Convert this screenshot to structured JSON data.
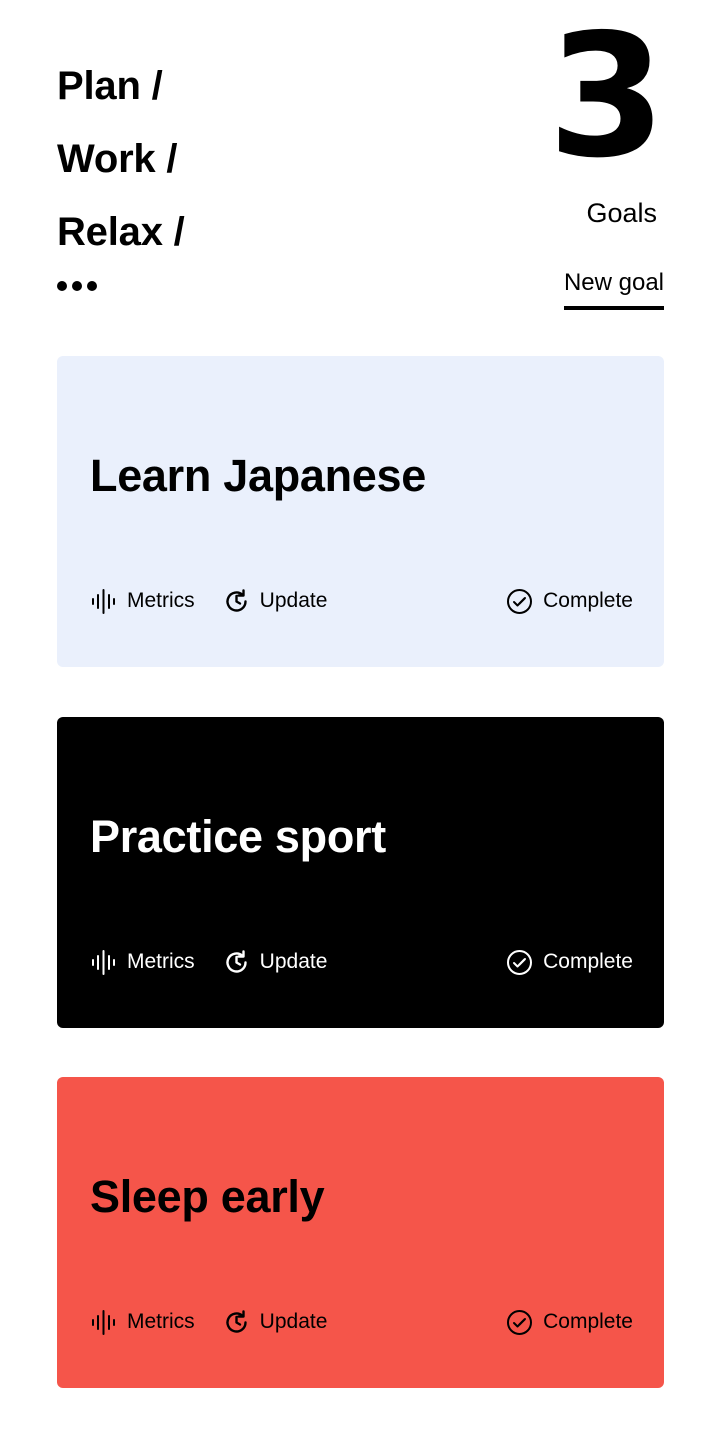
{
  "header": {
    "categories": [
      "Plan /",
      "Work /",
      "Relax /"
    ],
    "more_icon": "more-dots-icon",
    "goal_count": "3",
    "goal_count_label": "Goals",
    "new_goal_label": "New goal"
  },
  "actions": {
    "metrics_label": "Metrics",
    "metrics_icon": "waveform-icon",
    "update_label": "Update",
    "update_icon": "refresh-icon",
    "complete_label": "Complete",
    "complete_icon": "check-circle-icon"
  },
  "goals": [
    {
      "title": "Learn Japanese",
      "color": "#eaf0fc",
      "text_color": "#000000"
    },
    {
      "title": "Practice sport",
      "color": "#000000",
      "text_color": "#ffffff"
    },
    {
      "title": "Sleep early",
      "color": "#f5554a",
      "text_color": "#000000"
    }
  ]
}
